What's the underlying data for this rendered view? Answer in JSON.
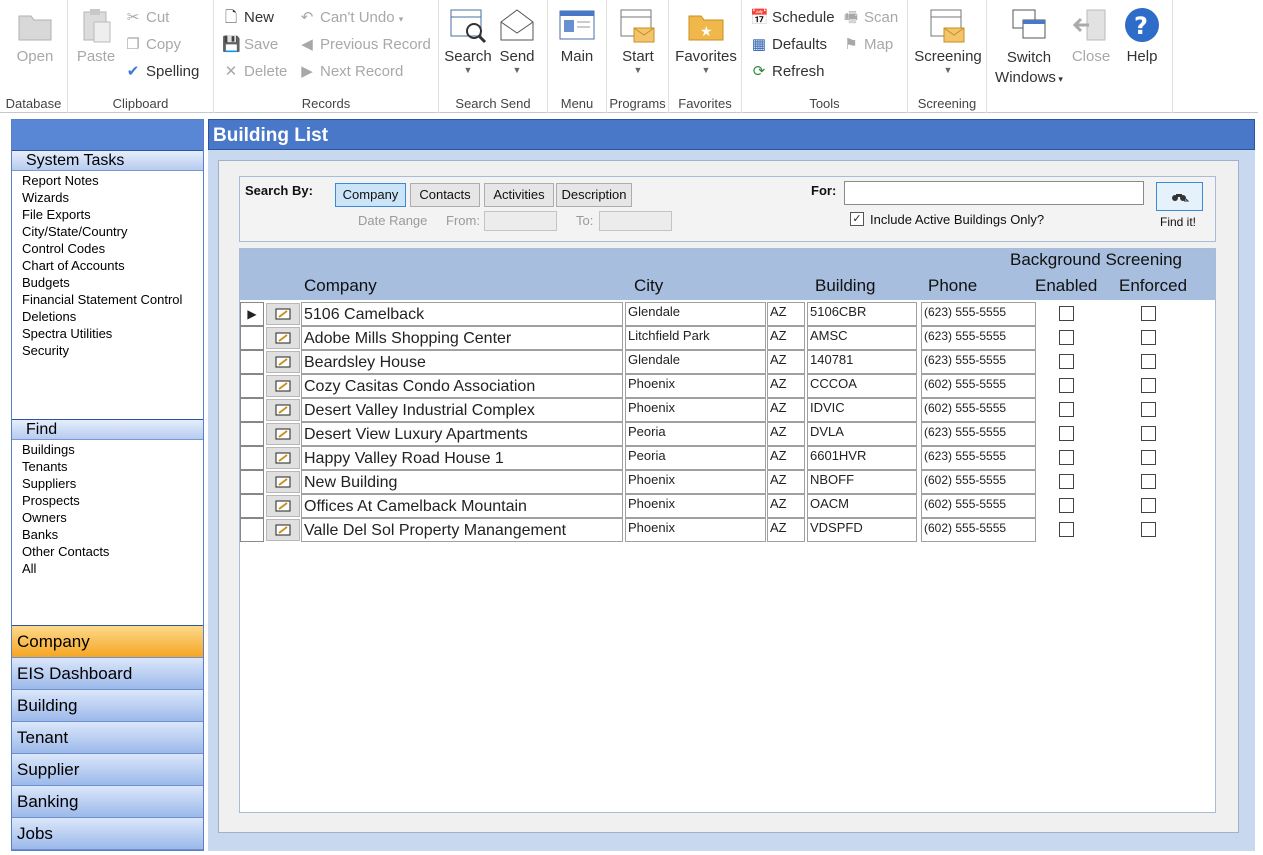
{
  "ribbon": {
    "database": {
      "label": "Database",
      "open": "Open"
    },
    "clipboard": {
      "label": "Clipboard",
      "paste": "Paste",
      "cut": "Cut",
      "copy": "Copy",
      "spelling": "Spelling"
    },
    "records": {
      "label": "Records",
      "new": "New",
      "save": "Save",
      "delete": "Delete",
      "cant_undo": "Can't Undo",
      "previous": "Previous Record",
      "next": "Next Record"
    },
    "search_send": {
      "label": "Search Send",
      "search": "Search",
      "send": "Send"
    },
    "menu": {
      "label": "Menu",
      "main": "Main"
    },
    "programs": {
      "label": "Programs",
      "start": "Start"
    },
    "favorites": {
      "label": "Favorites",
      "favorites": "Favorites"
    },
    "tools": {
      "label": "Tools",
      "schedule": "Schedule",
      "defaults": "Defaults",
      "refresh": "Refresh",
      "scan": "Scan",
      "map": "Map"
    },
    "screening": {
      "label": "Screening",
      "screening": "Screening"
    },
    "window": {
      "switch_line1": "Switch",
      "switch_line2": "Windows",
      "close": "Close",
      "help": "Help"
    }
  },
  "sidebar": {
    "system_tasks_title": "System Tasks",
    "system_tasks": [
      "Report Notes",
      "Wizards",
      "File Exports",
      "City/State/Country",
      "Control Codes",
      "Chart of Accounts",
      "Budgets",
      "Financial Statement Control",
      "Deletions",
      "Spectra Utilities",
      "Security"
    ],
    "find_title": "Find",
    "find_items": [
      "Buildings",
      "Tenants",
      "Suppliers",
      "Prospects",
      "Owners",
      "Banks",
      "Other Contacts",
      "All"
    ],
    "nav": [
      "Company",
      "EIS Dashboard",
      "Building",
      "Tenant",
      "Supplier",
      "Banking",
      "Jobs"
    ],
    "active_nav": "Company"
  },
  "main": {
    "title": "Building List",
    "search": {
      "search_by_label": "Search By:",
      "buttons": [
        "Company",
        "Contacts",
        "Activities",
        "Description"
      ],
      "selected": "Company",
      "date_range_label": "Date Range",
      "from_label": "From:",
      "to_label": "To:",
      "from_value": "",
      "to_value": "",
      "for_label": "For:",
      "for_value": "",
      "include_active_label": "Include Active Buildings Only?",
      "include_active_checked": true,
      "find_label": "Find it!"
    },
    "grid": {
      "group_header": "Background Screening",
      "columns": {
        "company": "Company",
        "city": "City",
        "building": "Building",
        "phone": "Phone",
        "enabled": "Enabled",
        "enforced": "Enforced"
      },
      "rows": [
        {
          "company": "5106 Camelback",
          "city": "Glendale",
          "state": "AZ",
          "building": "5106CBR",
          "phone": "(623) 555-5555",
          "enabled": false,
          "enforced": false,
          "current": true
        },
        {
          "company": "Adobe Mills Shopping Center",
          "city": "Litchfield Park",
          "state": "AZ",
          "building": "AMSC",
          "phone": "(623) 555-5555",
          "enabled": false,
          "enforced": false
        },
        {
          "company": "Beardsley House",
          "city": "Glendale",
          "state": "AZ",
          "building": "140781",
          "phone": "(623) 555-5555",
          "enabled": false,
          "enforced": false
        },
        {
          "company": "Cozy Casitas Condo Association",
          "city": "Phoenix",
          "state": "AZ",
          "building": "CCCOA",
          "phone": "(602) 555-5555",
          "enabled": false,
          "enforced": false
        },
        {
          "company": "Desert Valley Industrial Complex",
          "city": "Phoenix",
          "state": "AZ",
          "building": "IDVIC",
          "phone": "(602) 555-5555",
          "enabled": false,
          "enforced": false
        },
        {
          "company": "Desert View Luxury Apartments",
          "city": "Peoria",
          "state": "AZ",
          "building": "DVLA",
          "phone": "(623) 555-5555",
          "enabled": false,
          "enforced": false
        },
        {
          "company": "Happy Valley Road House 1",
          "city": "Peoria",
          "state": "AZ",
          "building": "6601HVR",
          "phone": "(623) 555-5555",
          "enabled": false,
          "enforced": false
        },
        {
          "company": "New Building",
          "city": "Phoenix",
          "state": "AZ",
          "building": "NBOFF",
          "phone": "(602) 555-5555",
          "enabled": false,
          "enforced": false
        },
        {
          "company": "Offices At Camelback Mountain",
          "city": "Phoenix",
          "state": "AZ",
          "building": "OACM",
          "phone": "(602) 555-5555",
          "enabled": false,
          "enforced": false
        },
        {
          "company": "Valle Del Sol Property Manangement",
          "city": "Phoenix",
          "state": "AZ",
          "building": "VDSPFD",
          "phone": "(602) 555-5555",
          "enabled": false,
          "enforced": false
        }
      ]
    }
  }
}
